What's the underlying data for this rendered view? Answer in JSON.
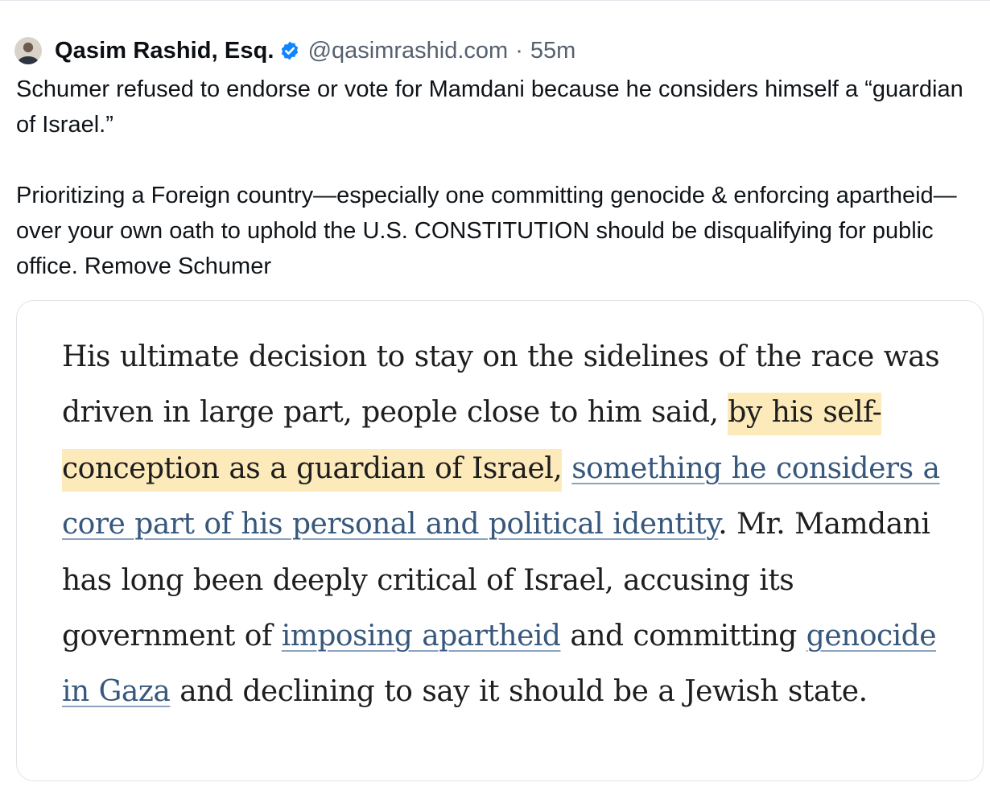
{
  "post": {
    "author": {
      "name": "Qasim Rashid, Esq.",
      "handle": "@qasimrashid.com",
      "separator": "·",
      "time": "55m",
      "verified_icon": "verified-check-icon",
      "avatar_icon": "avatar"
    },
    "text": {
      "paragraph_1": "Schumer refused to endorse or vote for Mamdani because he considers himself a “guardian of Israel.”",
      "paragraph_2": "Prioritizing a Foreign country—especially one committing genocide & enforcing apartheid—over your own oath to uphold the U.S. CONSTITUTION should be disqualifying for public office. Remove Schumer"
    },
    "embed": {
      "segment_1": "His ultimate decision to stay on the sidelines of the race was driven in large part, people close to him said, ",
      "highlight": "by his self-conception as a guardian of Israel,",
      "segment_2": " ",
      "link_1": "something he considers a core part of his personal and political identity",
      "segment_3": ". Mr. Mamdani has long been deeply critical of Israel, accusing its government of ",
      "link_2": "imposing apartheid",
      "segment_4": " and committing ",
      "link_3": "genocide in Gaza",
      "segment_5": " and declining to say it should be a Jewish state."
    }
  },
  "colors": {
    "highlight": "#fdeabb",
    "link": "#37587c",
    "verified": "#1185fe",
    "muted_text": "#56616f"
  }
}
